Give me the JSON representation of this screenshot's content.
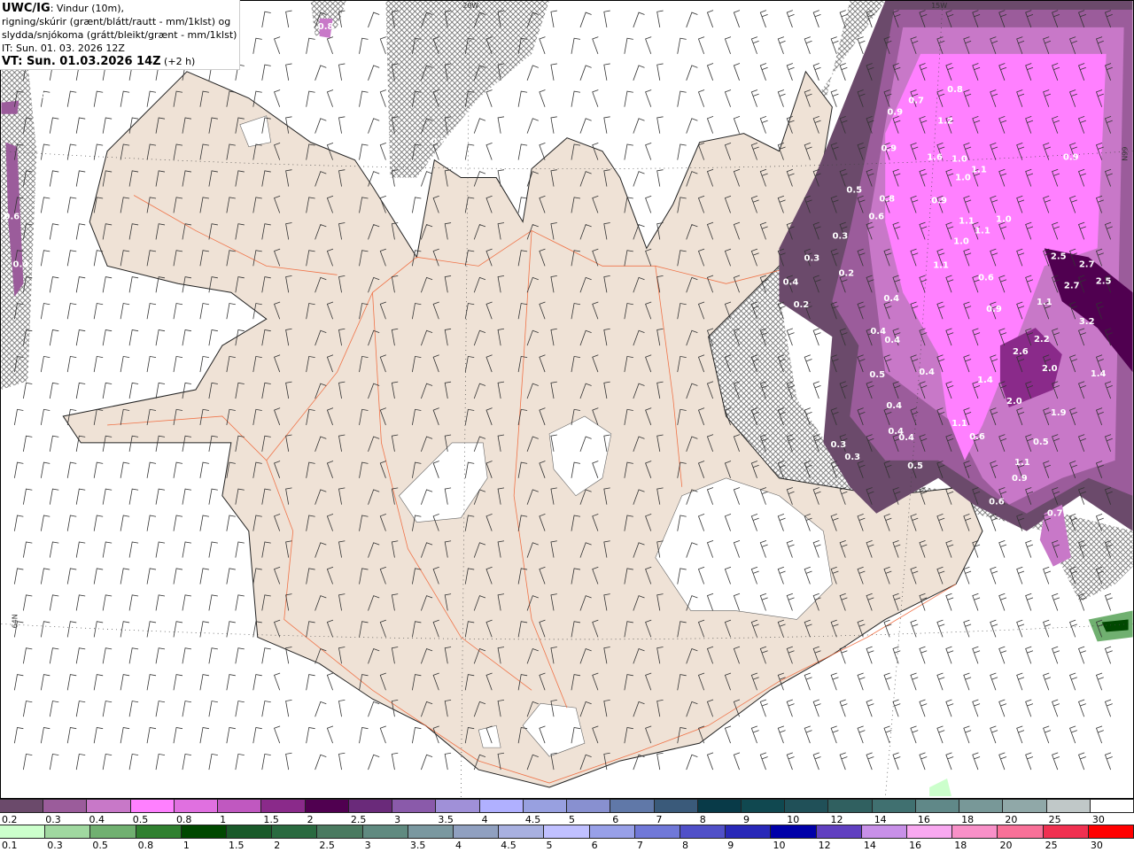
{
  "header": {
    "product": "UWC/IG",
    "line1": ": Vindur (10m),",
    "line2": "rigning/skúrir (grænt/blátt/rautt - mm/1klst) og",
    "line3": "slydda/snjókoma (grátt/bleikt/grænt - mm/1klst)",
    "it": "IT: Sun. 01. 03. 2026 12Z",
    "vt": "VT: Sun. 01.03.2026 14Z",
    "vt_offset": " (+2 h)"
  },
  "grid_labels": {
    "lon1": "20W",
    "lon2": "15W",
    "lat1": "66N",
    "lat2": "64N"
  },
  "precip_values": [
    "0.8",
    "0.7",
    "0.9",
    "1.2",
    "0.9",
    "1.6",
    "1.0",
    "1.1",
    "0.9",
    "1.0",
    "0.5",
    "0.8",
    "0.9",
    "0.6",
    "1.1",
    "1.0",
    "0.3",
    "1.1",
    "1.0",
    "0.3",
    "0.2",
    "1.1",
    "2.5",
    "2.7",
    "2.5",
    "0.4",
    "0.6",
    "2.7",
    "0.2",
    "0.4",
    "1.1",
    "0.9",
    "3.2",
    "0.4",
    "0.4",
    "2.2",
    "2.6",
    "2.0",
    "0.5",
    "0.4",
    "1.4",
    "1.4",
    "2.0",
    "1.9",
    "0.4",
    "1.1",
    "0.4",
    "0.4",
    "0.6",
    "0.5",
    "0.3",
    "0.3",
    "1.1",
    "0.5",
    "0.9",
    "0.6",
    "0.7",
    "0.8",
    "0.4",
    "0.3",
    "0.6",
    "0.4"
  ],
  "legend_snow": {
    "labels": [
      "0.2",
      "0.3",
      "0.4",
      "0.5",
      "0.8",
      "1",
      "1.5",
      "2",
      "2.5",
      "3",
      "3.5",
      "4",
      "4.5",
      "5",
      "6",
      "7",
      "8",
      "9",
      "10",
      "12",
      "14",
      "16",
      "18",
      "20",
      "25",
      "30"
    ],
    "colors": [
      "#6b4a6b",
      "#9b5c9b",
      "#c878c8",
      "#ff80ff",
      "#e070e0",
      "#c058c0",
      "#8a2a8a",
      "#500050",
      "#6a2a7a",
      "#8a5aaa",
      "#a090d8",
      "#b0b0ff",
      "#98a0e0",
      "#8890d0",
      "#6078a8",
      "#3a5a7a",
      "#083a48",
      "#104850",
      "#205058",
      "#306060",
      "#407070",
      "#608888",
      "#789898",
      "#90a8a8",
      "#c0c8c8",
      "#ffffff"
    ]
  },
  "legend_rain": {
    "labels": [
      "0.1",
      "0.3",
      "0.5",
      "0.8",
      "1",
      "1.5",
      "2",
      "2.5",
      "3",
      "3.5",
      "4",
      "4.5",
      "5",
      "6",
      "7",
      "8",
      "9",
      "10",
      "12",
      "14",
      "16",
      "18",
      "20",
      "25",
      "30"
    ],
    "colors": [
      "#ccffcc",
      "#a0d8a0",
      "#70b070",
      "#308030",
      "#004800",
      "#1a5a2a",
      "#2a6a40",
      "#4a7a60",
      "#608a80",
      "#7a98a0",
      "#90a0c0",
      "#a8b0e0",
      "#c0c0ff",
      "#98a0e8",
      "#7078d8",
      "#5050c8",
      "#2828b8",
      "#0000a8",
      "#6040c0",
      "#c890e8",
      "#f8a8f0",
      "#f890c8",
      "#f87098",
      "#f03050",
      "#ff0000"
    ]
  },
  "colors": {
    "land": "#efe2d6",
    "roads": "#f06030",
    "glacier": "#ffffff"
  }
}
